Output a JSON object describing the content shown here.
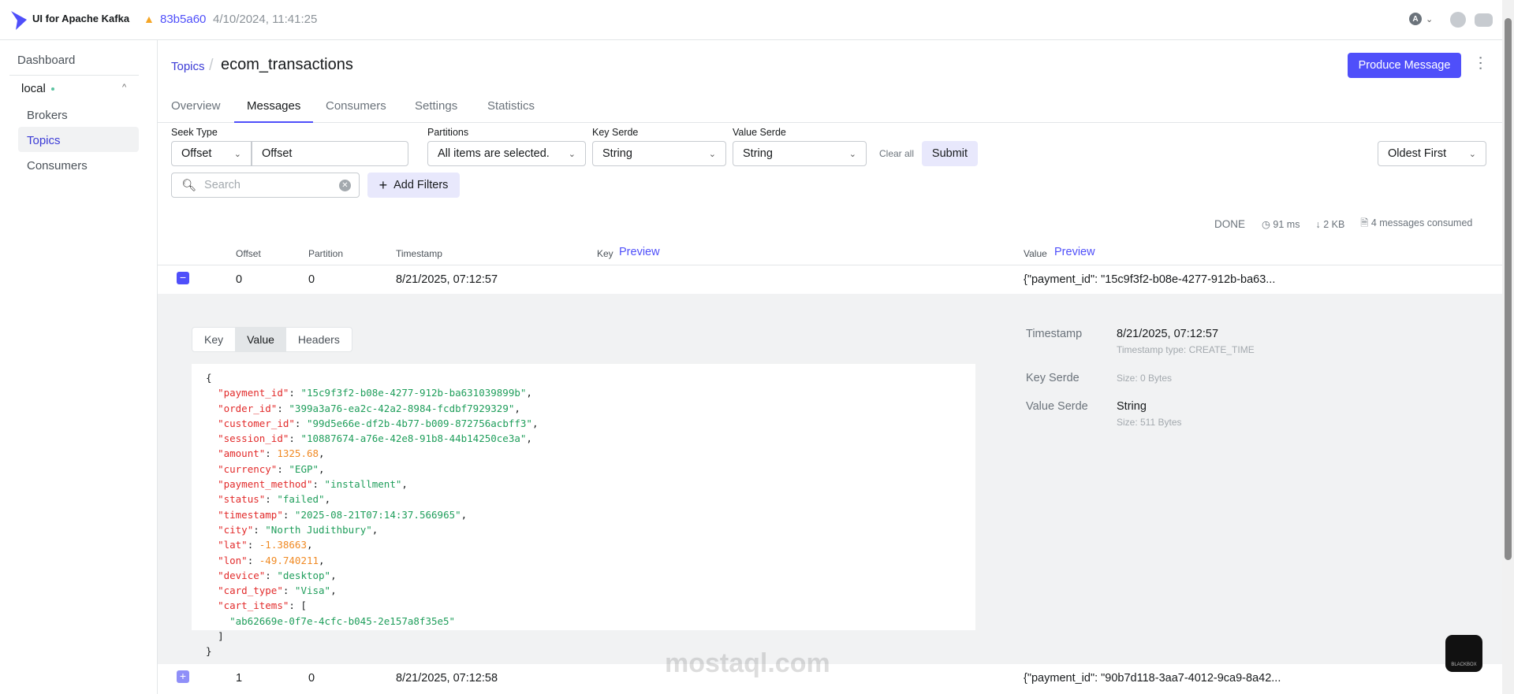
{
  "header": {
    "app_name": "UI for Apache Kafka",
    "commit": "83b5a60",
    "build_date": "4/10/2024, 11:41:25",
    "user_initial": "A"
  },
  "sidebar": {
    "dashboard": "Dashboard",
    "cluster": "local",
    "items": [
      "Brokers",
      "Topics",
      "Consumers"
    ]
  },
  "breadcrumb": {
    "parent": "Topics",
    "current": "ecom_transactions"
  },
  "produce_label": "Produce Message",
  "tabs": [
    "Overview",
    "Messages",
    "Consumers",
    "Settings",
    "Statistics"
  ],
  "filters": {
    "seek_type_label": "Seek Type",
    "seek_type": "Offset",
    "offset_value": "Offset",
    "partitions_label": "Partitions",
    "partitions": "All items are selected.",
    "key_serde_label": "Key Serde",
    "key_serde": "String",
    "value_serde_label": "Value Serde",
    "value_serde": "String",
    "clear_all": "Clear all",
    "submit": "Submit",
    "sort": "Oldest First",
    "search_placeholder": "Search",
    "add_filters": "Add Filters"
  },
  "status": {
    "state": "DONE",
    "time": "91 ms",
    "size": "2 KB",
    "consumed": "4 messages consumed"
  },
  "table": {
    "headers": {
      "offset": "Offset",
      "partition": "Partition",
      "timestamp": "Timestamp",
      "key": "Key",
      "value": "Value",
      "preview": "Preview"
    },
    "rows": [
      {
        "offset": "0",
        "partition": "0",
        "timestamp": "8/21/2025, 07:12:57",
        "value": "{\"payment_id\": \"15c9f3f2-b08e-4277-912b-ba63..."
      },
      {
        "offset": "1",
        "partition": "0",
        "timestamp": "8/21/2025, 07:12:58",
        "value": "{\"payment_id\": \"90b7d118-3aa7-4012-9ca9-8a42..."
      }
    ]
  },
  "detail": {
    "tabs": [
      "Key",
      "Value",
      "Headers"
    ],
    "json": [
      [
        "payment_id",
        "\"15c9f3f2-b08e-4277-912b-ba631039899b\"",
        "s"
      ],
      [
        "order_id",
        "\"399a3a76-ea2c-42a2-8984-fcdbf7929329\"",
        "s"
      ],
      [
        "customer_id",
        "\"99d5e66e-df2b-4b77-b009-872756acbff3\"",
        "s"
      ],
      [
        "session_id",
        "\"10887674-a76e-42e8-91b8-44b14250ce3a\"",
        "s"
      ],
      [
        "amount",
        "1325.68",
        "n"
      ],
      [
        "currency",
        "\"EGP\"",
        "s"
      ],
      [
        "payment_method",
        "\"installment\"",
        "s"
      ],
      [
        "status",
        "\"failed\"",
        "s"
      ],
      [
        "timestamp",
        "\"2025-08-21T07:14:37.566965\"",
        "s"
      ],
      [
        "city",
        "\"North Judithbury\"",
        "s"
      ],
      [
        "lat",
        "-1.38663",
        "n"
      ],
      [
        "lon",
        "-49.740211",
        "n"
      ],
      [
        "device",
        "\"desktop\"",
        "s"
      ],
      [
        "card_type",
        "\"Visa\"",
        "s"
      ]
    ],
    "cart_items_key": "cart_items",
    "cart_items": [
      "\"ab62669e-0f7e-4cfc-b045-2e157a8f35e5\""
    ],
    "meta": {
      "timestamp_label": "Timestamp",
      "timestamp": "8/21/2025, 07:12:57",
      "timestamp_type": "Timestamp type: CREATE_TIME",
      "key_serde_label": "Key Serde",
      "key_size": "Size: 0 Bytes",
      "value_serde_label": "Value Serde",
      "value_serde": "String",
      "value_size": "Size: 511 Bytes"
    }
  },
  "watermark": "mostaql.com",
  "badge": "BLACKBOX"
}
